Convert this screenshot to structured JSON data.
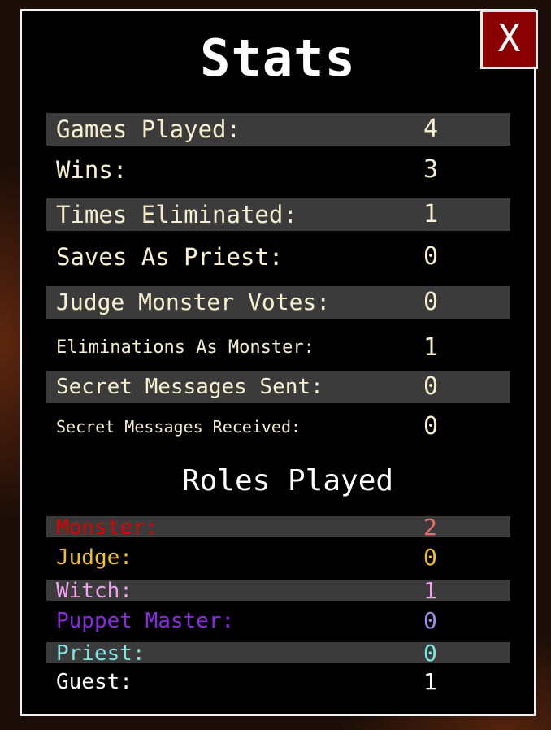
{
  "title": "Stats",
  "close_label": "X",
  "stats": [
    {
      "label": "Games Played:",
      "value": "4"
    },
    {
      "label": "Wins:",
      "value": "3"
    },
    {
      "label": "Times Eliminated:",
      "value": "1"
    },
    {
      "label": "Saves As Priest:",
      "value": "0"
    },
    {
      "label": "Judge Monster Votes:",
      "value": "0"
    },
    {
      "label": "Eliminations As Monster:",
      "value": "1"
    },
    {
      "label": "Secret Messages Sent:",
      "value": "0"
    },
    {
      "label": "Secret Messages Received:",
      "value": "0"
    }
  ],
  "roles_title": "Roles Played",
  "roles": [
    {
      "label": "Monster:",
      "value": "2",
      "label_color": "#e00000",
      "value_color": "#f06a6a"
    },
    {
      "label": "Judge:",
      "value": "0",
      "label_color": "#f0c21a",
      "value_color": "#f0c21a"
    },
    {
      "label": "Witch:",
      "value": "1",
      "label_color": "#f0a2f0",
      "value_color": "#f0a2f0"
    },
    {
      "label": "Puppet Master:",
      "value": "0",
      "label_color": "#8a2be2",
      "value_color": "#9b8ff0"
    },
    {
      "label": "Priest:",
      "value": "0",
      "label_color": "#7fe3e3",
      "value_color": "#7fe3e3"
    },
    {
      "label": "Guest:",
      "value": "1",
      "label_color": "#ffffff",
      "value_color": "#ffffff"
    }
  ],
  "colors": {
    "panel_bg": "#000000",
    "panel_border": "#f2f2f2",
    "row_shade": "#3b3b3b",
    "stat_text": "#f7efcf",
    "close_bg": "#8b0000"
  }
}
